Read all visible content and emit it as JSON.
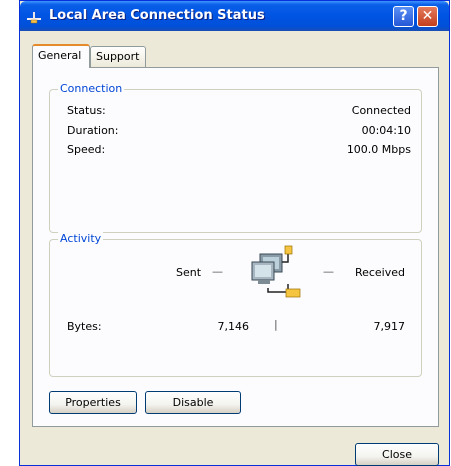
{
  "window": {
    "title": "Local Area Connection Status",
    "help_label": "?",
    "close_glyph": "✕"
  },
  "tabs": [
    {
      "label": "General",
      "selected": true
    },
    {
      "label": "Support",
      "selected": false
    }
  ],
  "connection": {
    "group_label": "Connection",
    "status_label": "Status:",
    "status_value": "Connected",
    "duration_label": "Duration:",
    "duration_value": "00:04:10",
    "speed_label": "Speed:",
    "speed_value": "100.0 Mbps"
  },
  "activity": {
    "group_label": "Activity",
    "sent_label": "Sent",
    "received_label": "Received",
    "bytes_label": "Bytes:",
    "bytes_sent": "7,146",
    "bytes_received": "7,917",
    "separator": "|",
    "dash": "—"
  },
  "buttons": {
    "properties": "Properties",
    "disable": "Disable",
    "close": "Close"
  },
  "icons": {
    "title": "network-connection-icon",
    "activity": "network-computers-icon"
  }
}
